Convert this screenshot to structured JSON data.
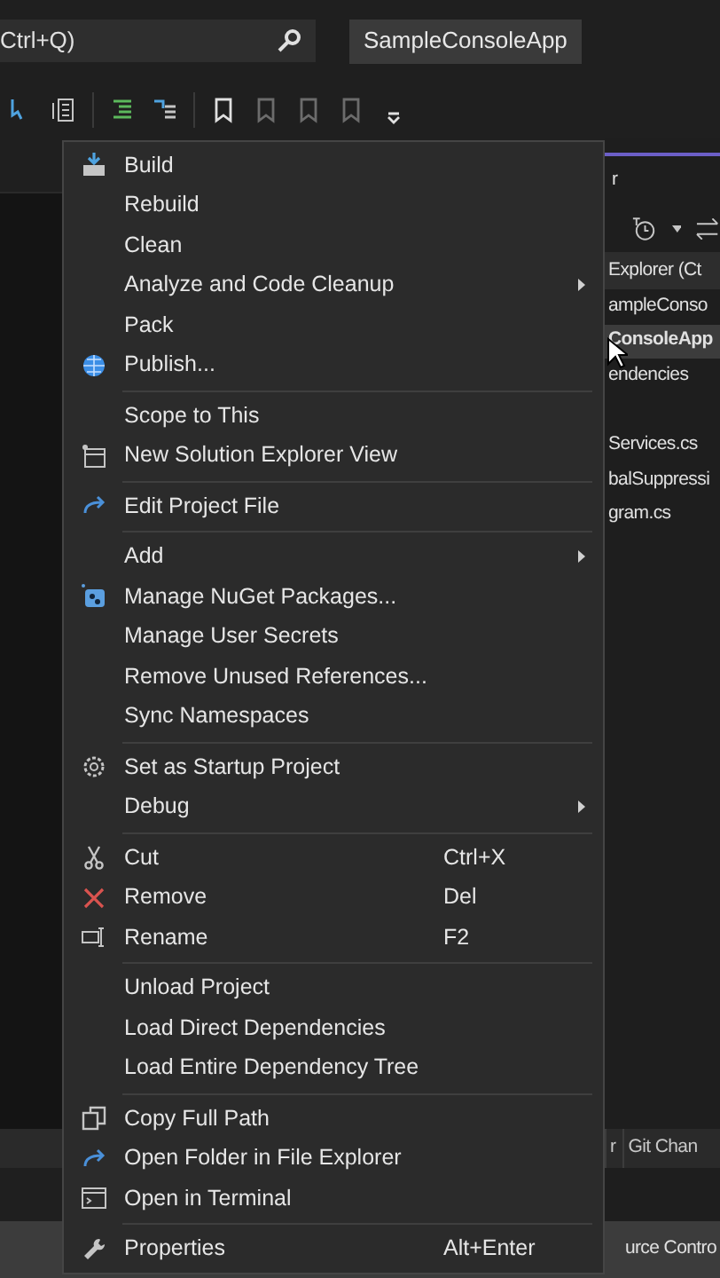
{
  "search": {
    "value": "Ctrl+Q)"
  },
  "solution_button": {
    "label": "SampleConsoleApp"
  },
  "context_menu": {
    "groups": [
      {
        "items": [
          {
            "label": "Build",
            "submenu": false
          },
          {
            "label": "Rebuild",
            "submenu": false
          },
          {
            "label": "Clean",
            "submenu": false
          },
          {
            "label": "Analyze and Code Cleanup",
            "submenu": true
          },
          {
            "label": "Pack",
            "submenu": false
          },
          {
            "label": "Publish...",
            "submenu": false
          }
        ]
      },
      {
        "items": [
          {
            "label": "Scope to This",
            "submenu": false
          },
          {
            "label": "New Solution Explorer View",
            "submenu": false
          }
        ]
      },
      {
        "items": [
          {
            "label": "Edit Project File",
            "submenu": false
          }
        ]
      },
      {
        "items": [
          {
            "label": "Add",
            "submenu": true
          },
          {
            "label": "Manage NuGet Packages...",
            "submenu": false
          },
          {
            "label": "Manage User Secrets",
            "submenu": false
          },
          {
            "label": "Remove Unused References...",
            "submenu": false
          },
          {
            "label": "Sync Namespaces",
            "submenu": false
          }
        ]
      },
      {
        "items": [
          {
            "label": "Set as Startup Project",
            "submenu": false
          },
          {
            "label": "Debug",
            "submenu": true
          }
        ]
      },
      {
        "items": [
          {
            "label": "Cut",
            "shortcut": "Ctrl+X",
            "submenu": false
          },
          {
            "label": "Remove",
            "shortcut": "Del",
            "submenu": false
          },
          {
            "label": "Rename",
            "shortcut": "F2",
            "submenu": false
          }
        ]
      },
      {
        "items": [
          {
            "label": "Unload Project",
            "submenu": false
          },
          {
            "label": "Load Direct Dependencies",
            "submenu": false
          },
          {
            "label": "Load Entire Dependency Tree",
            "submenu": false
          }
        ]
      },
      {
        "items": [
          {
            "label": "Copy Full Path",
            "submenu": false
          },
          {
            "label": "Open Folder in File Explorer",
            "submenu": false
          },
          {
            "label": "Open in Terminal",
            "submenu": false
          }
        ]
      },
      {
        "items": [
          {
            "label": "Properties",
            "shortcut": "Alt+Enter",
            "submenu": false
          }
        ]
      }
    ]
  },
  "solution_explorer": {
    "title": "r",
    "header": "Explorer (Ct",
    "tree": [
      {
        "label": "ampleConso",
        "selected": false
      },
      {
        "label": "ConsoleApp",
        "selected": true
      },
      {
        "label": "endencies",
        "selected": false
      },
      {
        "label": "Services.cs",
        "selected": false
      },
      {
        "label": "balSuppressi",
        "selected": false
      },
      {
        "label": "gram.cs",
        "selected": false
      }
    ],
    "bottom_tabs": [
      {
        "label": "r",
        "selected": false
      },
      {
        "label": "Git Chan",
        "selected": false
      }
    ]
  },
  "status_bar": {
    "text": "urce Contro"
  }
}
